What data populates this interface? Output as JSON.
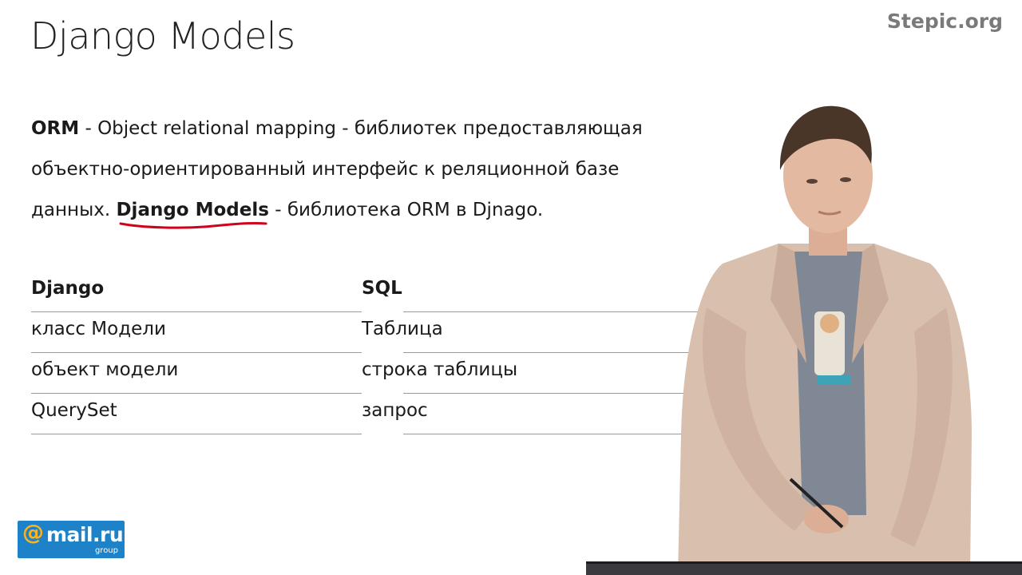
{
  "slide": {
    "title": "Django Models",
    "brand": "Stepic.org"
  },
  "definition": {
    "term": "ORM",
    "text1": " - Object relational mapping - библиотек предоставляющая объектно-ориентированный интерфейс к реляционной базе данных. ",
    "highlight": "Django Models",
    "text2": " - библиотека ORM в Djnago."
  },
  "table": {
    "headers": [
      "Django",
      "SQL"
    ],
    "rows": [
      [
        "класс Модели",
        "Таблица"
      ],
      [
        "объект модели",
        "строка таблицы"
      ],
      [
        "QuerySet",
        "запрос"
      ]
    ]
  },
  "logo": {
    "at": "@",
    "name": "mail.ru",
    "sub": "group"
  },
  "colors": {
    "logo_bg": "#1e82c8",
    "logo_at": "#ffb21a",
    "underline": "#d0021b",
    "brand": "#7a7a7a"
  }
}
